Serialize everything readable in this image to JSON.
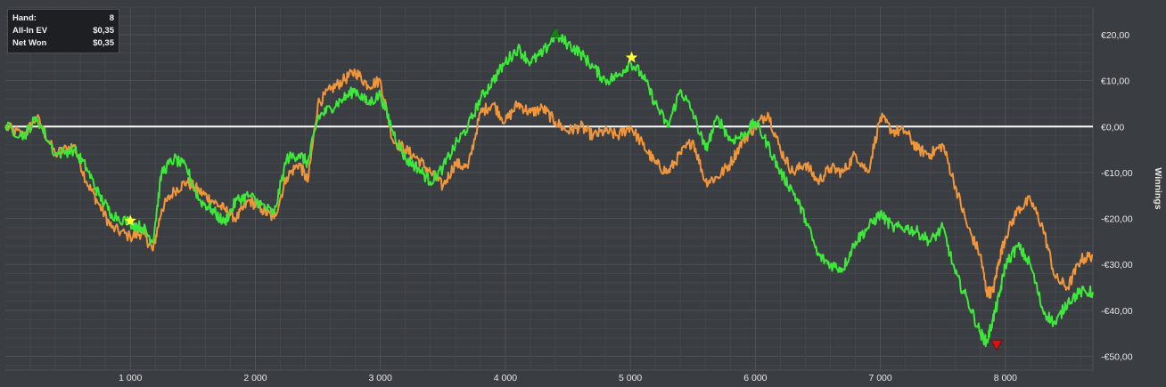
{
  "info_box": {
    "rows": [
      {
        "label": "Hand:",
        "value": "8"
      },
      {
        "label": "All-In EV",
        "value": "$0,35"
      },
      {
        "label": "Net Won",
        "value": "$0,35"
      }
    ]
  },
  "colors": {
    "background": "#3a3d42",
    "grid_major": "#4e5258",
    "grid_minor": "#44474c",
    "zero_line": "#ffffff",
    "net_won": "#3ee83a",
    "all_in_ev": "#f0953a",
    "star": "#ffff33",
    "max_marker": "#1f7a1f",
    "min_marker": "#e01010"
  },
  "chart_data": {
    "type": "line",
    "ylabel": "Winnings",
    "xlim": [
      0,
      8700
    ],
    "ylim": [
      -53,
      26
    ],
    "x_ticks": [
      {
        "value": 1000,
        "label": "1 000"
      },
      {
        "value": 2000,
        "label": "2 000"
      },
      {
        "value": 3000,
        "label": "3 000"
      },
      {
        "value": 4000,
        "label": "4 000"
      },
      {
        "value": 5000,
        "label": "5 000"
      },
      {
        "value": 6000,
        "label": "6 000"
      },
      {
        "value": 7000,
        "label": "7 000"
      },
      {
        "value": 8000,
        "label": "8 000"
      }
    ],
    "y_ticks": [
      {
        "value": 20,
        "label": "€20,00"
      },
      {
        "value": 10,
        "label": "€10,00"
      },
      {
        "value": 0,
        "label": "€0,00"
      },
      {
        "value": -10,
        "label": "-€10,00"
      },
      {
        "value": -20,
        "label": "-€20,00"
      },
      {
        "value": -30,
        "label": "-€30,00"
      },
      {
        "value": -40,
        "label": "-€40,00"
      },
      {
        "value": -50,
        "label": "-€50,00"
      }
    ],
    "grid": true,
    "series": [
      {
        "key": "all_in_ev",
        "color": "#f0953a",
        "x": [
          0,
          150,
          250,
          400,
          550,
          650,
          750,
          850,
          1000,
          1100,
          1180,
          1250,
          1350,
          1450,
          1550,
          1650,
          1750,
          1850,
          1950,
          2050,
          2150,
          2250,
          2350,
          2420,
          2500,
          2600,
          2700,
          2800,
          2900,
          3000,
          3100,
          3200,
          3300,
          3400,
          3500,
          3600,
          3700,
          3800,
          3900,
          4000,
          4100,
          4200,
          4300,
          4400,
          4500,
          4600,
          4700,
          4800,
          4900,
          5000,
          5100,
          5200,
          5300,
          5400,
          5500,
          5600,
          5700,
          5800,
          5900,
          6000,
          6100,
          6200,
          6300,
          6400,
          6500,
          6600,
          6700,
          6800,
          6900,
          7000,
          7100,
          7200,
          7300,
          7400,
          7500,
          7600,
          7700,
          7800,
          7850,
          7900,
          7950,
          8000,
          8100,
          8200,
          8300,
          8400,
          8500,
          8600,
          8700
        ],
        "values": [
          0,
          -2,
          2,
          -6,
          -4,
          -12,
          -17,
          -22,
          -24,
          -23,
          -27,
          -18,
          -14,
          -12,
          -14,
          -16,
          -18,
          -20,
          -16,
          -18,
          -20,
          -11,
          -8,
          -12,
          5,
          8,
          10,
          12,
          9,
          10,
          -3,
          -5,
          -7,
          -10,
          -13,
          -8,
          -9,
          3,
          5,
          1,
          5,
          3,
          4,
          1,
          -1,
          0,
          -2,
          -1,
          -2,
          0,
          -4,
          -8,
          -10,
          -6,
          -3,
          -12,
          -11,
          -8,
          -3,
          0,
          3,
          -5,
          -10,
          -8,
          -12,
          -9,
          -10,
          -6,
          -10,
          2,
          -1,
          -1,
          -5,
          -6,
          -4,
          -13,
          -22,
          -28,
          -36,
          -36,
          -29,
          -24,
          -18,
          -16,
          -22,
          -33,
          -35,
          -29,
          -28
        ]
      },
      {
        "key": "net_won",
        "color": "#3ee83a",
        "x": [
          0,
          150,
          250,
          400,
          550,
          650,
          750,
          850,
          1000,
          1100,
          1180,
          1250,
          1350,
          1450,
          1550,
          1650,
          1750,
          1850,
          1950,
          2050,
          2150,
          2250,
          2350,
          2420,
          2500,
          2600,
          2700,
          2800,
          2900,
          3000,
          3100,
          3200,
          3300,
          3400,
          3500,
          3600,
          3700,
          3800,
          3900,
          4000,
          4100,
          4200,
          4300,
          4400,
          4500,
          4600,
          4700,
          4800,
          4900,
          5000,
          5100,
          5200,
          5300,
          5400,
          5500,
          5600,
          5700,
          5800,
          5900,
          6000,
          6100,
          6200,
          6300,
          6400,
          6500,
          6600,
          6700,
          6800,
          6900,
          7000,
          7100,
          7200,
          7300,
          7400,
          7500,
          7600,
          7700,
          7800,
          7850,
          7900,
          7950,
          8000,
          8100,
          8200,
          8300,
          8400,
          8500,
          8600,
          8700
        ],
        "values": [
          0,
          -2,
          2,
          -6,
          -5,
          -9,
          -15,
          -19,
          -21,
          -22,
          -25,
          -10,
          -7,
          -9,
          -16,
          -18,
          -21,
          -16,
          -15,
          -17,
          -19,
          -7,
          -6,
          -8,
          2,
          4,
          6,
          8,
          5,
          7,
          -1,
          -7,
          -9,
          -12,
          -9,
          -4,
          0,
          6,
          10,
          14,
          17,
          14,
          16,
          20,
          18,
          16,
          13,
          10,
          11,
          14,
          11,
          5,
          0,
          8,
          3,
          -5,
          2,
          -3,
          -2,
          1,
          -4,
          -10,
          -14,
          -20,
          -28,
          -30,
          -31,
          -25,
          -22,
          -19,
          -22,
          -22,
          -23,
          -25,
          -22,
          -32,
          -38,
          -45,
          -47,
          -42,
          -37,
          -30,
          -26,
          -30,
          -40,
          -43,
          -38,
          -36,
          -36
        ]
      }
    ],
    "markers": [
      {
        "type": "star",
        "x": 1000,
        "y": -20.5,
        "color": "#ffff33"
      },
      {
        "type": "star",
        "x": 5010,
        "y": 15,
        "color": "#ffff33"
      },
      {
        "type": "triangle-up",
        "x": 4400,
        "y": 20.5,
        "color": "#1f7a1f"
      },
      {
        "type": "triangle-down",
        "x": 7930,
        "y": -47.5,
        "color": "#e01010"
      }
    ]
  }
}
